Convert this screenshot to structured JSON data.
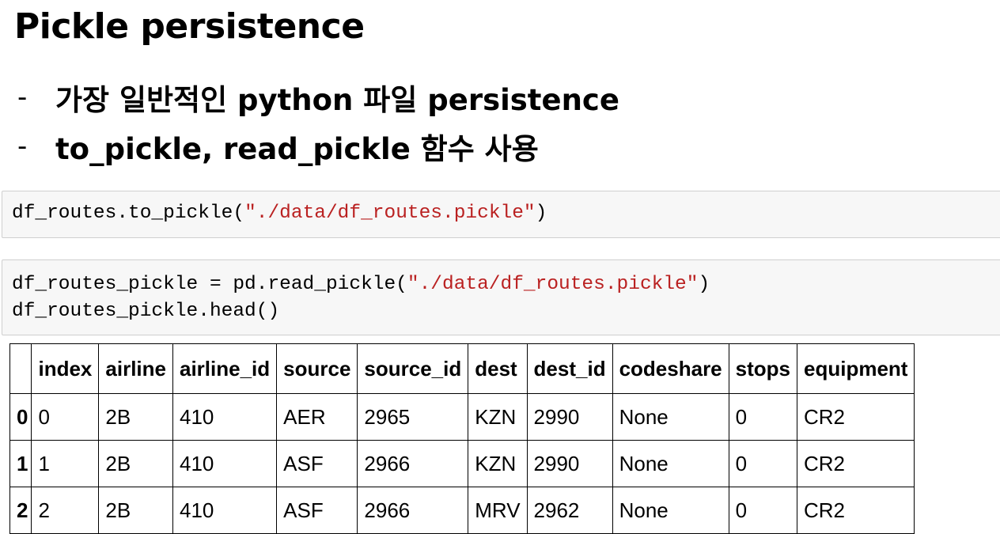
{
  "title": "Pickle persistence",
  "bullets": [
    {
      "dash": "-",
      "text": "가장 일반적인 python 파일 persistence"
    },
    {
      "dash": "-",
      "text": "to_pickle, read_pickle 함수 사용"
    }
  ],
  "cells": {
    "cell1": {
      "code_prefix": "df_routes.to_pickle(",
      "string": "\"./data/df_routes.pickle\"",
      "code_suffix": ")"
    },
    "cell2": {
      "line1_prefix": "df_routes_pickle = pd.read_pickle(",
      "line1_string": "\"./data/df_routes.pickle\"",
      "line1_suffix": ")",
      "line2": "df_routes_pickle.head()"
    }
  },
  "table": {
    "corner": "",
    "columns": [
      "index",
      "airline",
      "airline_id",
      "source",
      "source_id",
      "dest",
      "dest_id",
      "codeshare",
      "stops",
      "equipment"
    ],
    "rows": [
      {
        "idx": "0",
        "values": [
          "0",
          "2B",
          "410",
          "AER",
          "2965",
          "KZN",
          "2990",
          "None",
          "0",
          "CR2"
        ]
      },
      {
        "idx": "1",
        "values": [
          "1",
          "2B",
          "410",
          "ASF",
          "2966",
          "KZN",
          "2990",
          "None",
          "0",
          "CR2"
        ]
      },
      {
        "idx": "2",
        "values": [
          "2",
          "2B",
          "410",
          "ASF",
          "2966",
          "MRV",
          "2962",
          "None",
          "0",
          "CR2"
        ]
      }
    ]
  },
  "colors": {
    "string": "#ba2121",
    "cell_bg": "#f7f7f7",
    "cell_border": "#cfcfcf"
  }
}
